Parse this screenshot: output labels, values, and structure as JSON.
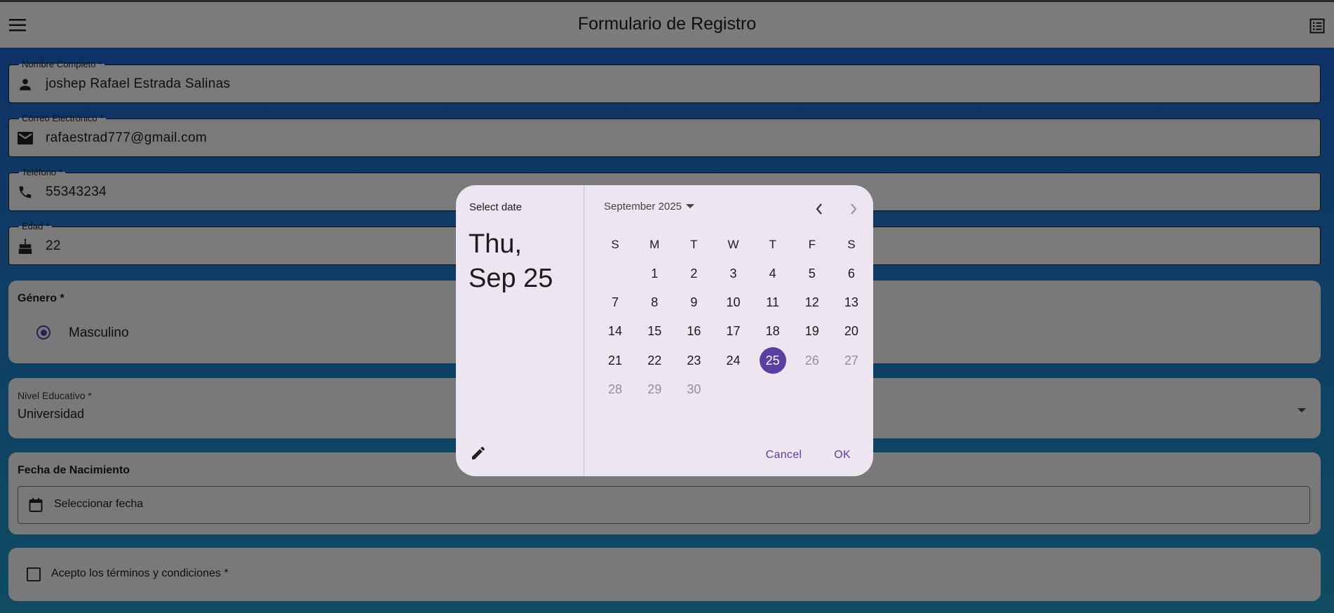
{
  "appbar": {
    "title": "Formulario de Registro",
    "menu_icon": "menu-icon",
    "list_icon": "list-icon"
  },
  "fields": {
    "name": {
      "label": "Nombre Completo *",
      "value": "joshep Rafael Estrada Salinas",
      "icon": "person-icon"
    },
    "email": {
      "label": "Correo Electrónico *",
      "value": "rafaestrad777@gmail.com",
      "icon": "mail-icon"
    },
    "phone": {
      "label": "Teléfono *",
      "value": "55343234",
      "icon": "phone-icon"
    },
    "age": {
      "label": "Edad *",
      "value": "22",
      "icon": "cake-icon"
    }
  },
  "gender": {
    "title": "Género *",
    "option": "Masculino"
  },
  "education": {
    "label": "Nivel Educativo *",
    "value": "Universidad"
  },
  "birthdate": {
    "title": "Fecha de Nacimiento",
    "button_label": "Seleccionar fecha"
  },
  "terms": {
    "label": "Acepto los términos y condiciones *"
  },
  "datepicker": {
    "help_text": "Select date",
    "headline_line1": "Thu,",
    "headline_line2": "Sep 25",
    "month_label": "September 2025",
    "weekdays": [
      "S",
      "M",
      "T",
      "W",
      "T",
      "F",
      "S"
    ],
    "weeks": [
      [
        "",
        "1",
        "2",
        "3",
        "4",
        "5",
        "6"
      ],
      [
        "7",
        "8",
        "9",
        "10",
        "11",
        "12",
        "13"
      ],
      [
        "14",
        "15",
        "16",
        "17",
        "18",
        "19",
        "20"
      ],
      [
        "21",
        "22",
        "23",
        "24",
        "25",
        "26",
        "27"
      ],
      [
        "28",
        "29",
        "30",
        "",
        "",
        "",
        ""
      ]
    ],
    "selected_day": "25",
    "disabled_days": [
      "26",
      "27",
      "28",
      "29",
      "30"
    ],
    "cancel_label": "Cancel",
    "ok_label": "OK",
    "accent_color": "#5b3fa0"
  }
}
